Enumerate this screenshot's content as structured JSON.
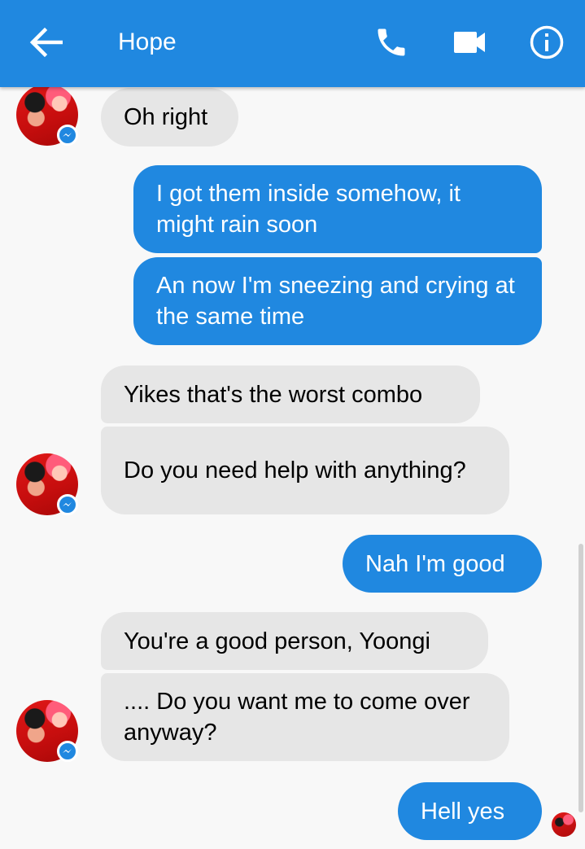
{
  "header": {
    "title": "Hope",
    "icons": [
      "back-arrow-icon",
      "phone-icon",
      "video-camera-icon",
      "info-icon"
    ],
    "background": "#2088e0"
  },
  "messages": [
    {
      "sender": "contact",
      "text": "Oh right"
    },
    {
      "sender": "me",
      "text": "I got them inside somehow, it might rain soon"
    },
    {
      "sender": "me",
      "text": "An now I'm sneezing and crying at the same time"
    },
    {
      "sender": "contact",
      "text": "Yikes that's the worst combo"
    },
    {
      "sender": "contact",
      "text": "Do you need help with anything?"
    },
    {
      "sender": "me",
      "text": "Nah I'm good"
    },
    {
      "sender": "contact",
      "text": "You're a good person, Yoongi"
    },
    {
      "sender": "contact",
      "text": ".... Do you want me to come over anyway?"
    },
    {
      "sender": "me",
      "text": "Hell yes"
    }
  ],
  "colors": {
    "outgoing_bubble": "#2088e0",
    "incoming_bubble": "#e6e6e6",
    "background": "#f8f8f8"
  }
}
